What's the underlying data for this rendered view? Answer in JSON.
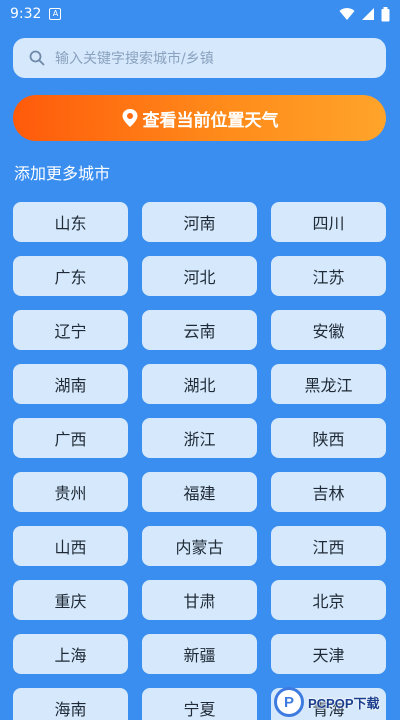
{
  "status_bar": {
    "time": "9:32",
    "app_icon": "A"
  },
  "search": {
    "placeholder": "输入关键字搜索城市/乡镇",
    "icon": "search-icon"
  },
  "locate_button": {
    "label": "查看当前位置天气",
    "icon": "location-pin-icon"
  },
  "section_title": "添加更多城市",
  "provinces": [
    "山东",
    "河南",
    "四川",
    "广东",
    "河北",
    "江苏",
    "辽宁",
    "云南",
    "安徽",
    "湖南",
    "湖北",
    "黑龙江",
    "广西",
    "浙江",
    "陕西",
    "贵州",
    "福建",
    "吉林",
    "山西",
    "内蒙古",
    "江西",
    "重庆",
    "甘肃",
    "北京",
    "上海",
    "新疆",
    "天津",
    "海南",
    "宁夏",
    "青海"
  ],
  "watermark": {
    "logo": "P",
    "text": "PCPOP下载"
  },
  "colors": {
    "background": "#3a8ef0",
    "chip": "#d6e8fb",
    "accent_start": "#ff5a0a",
    "accent_end": "#ffa42a"
  }
}
